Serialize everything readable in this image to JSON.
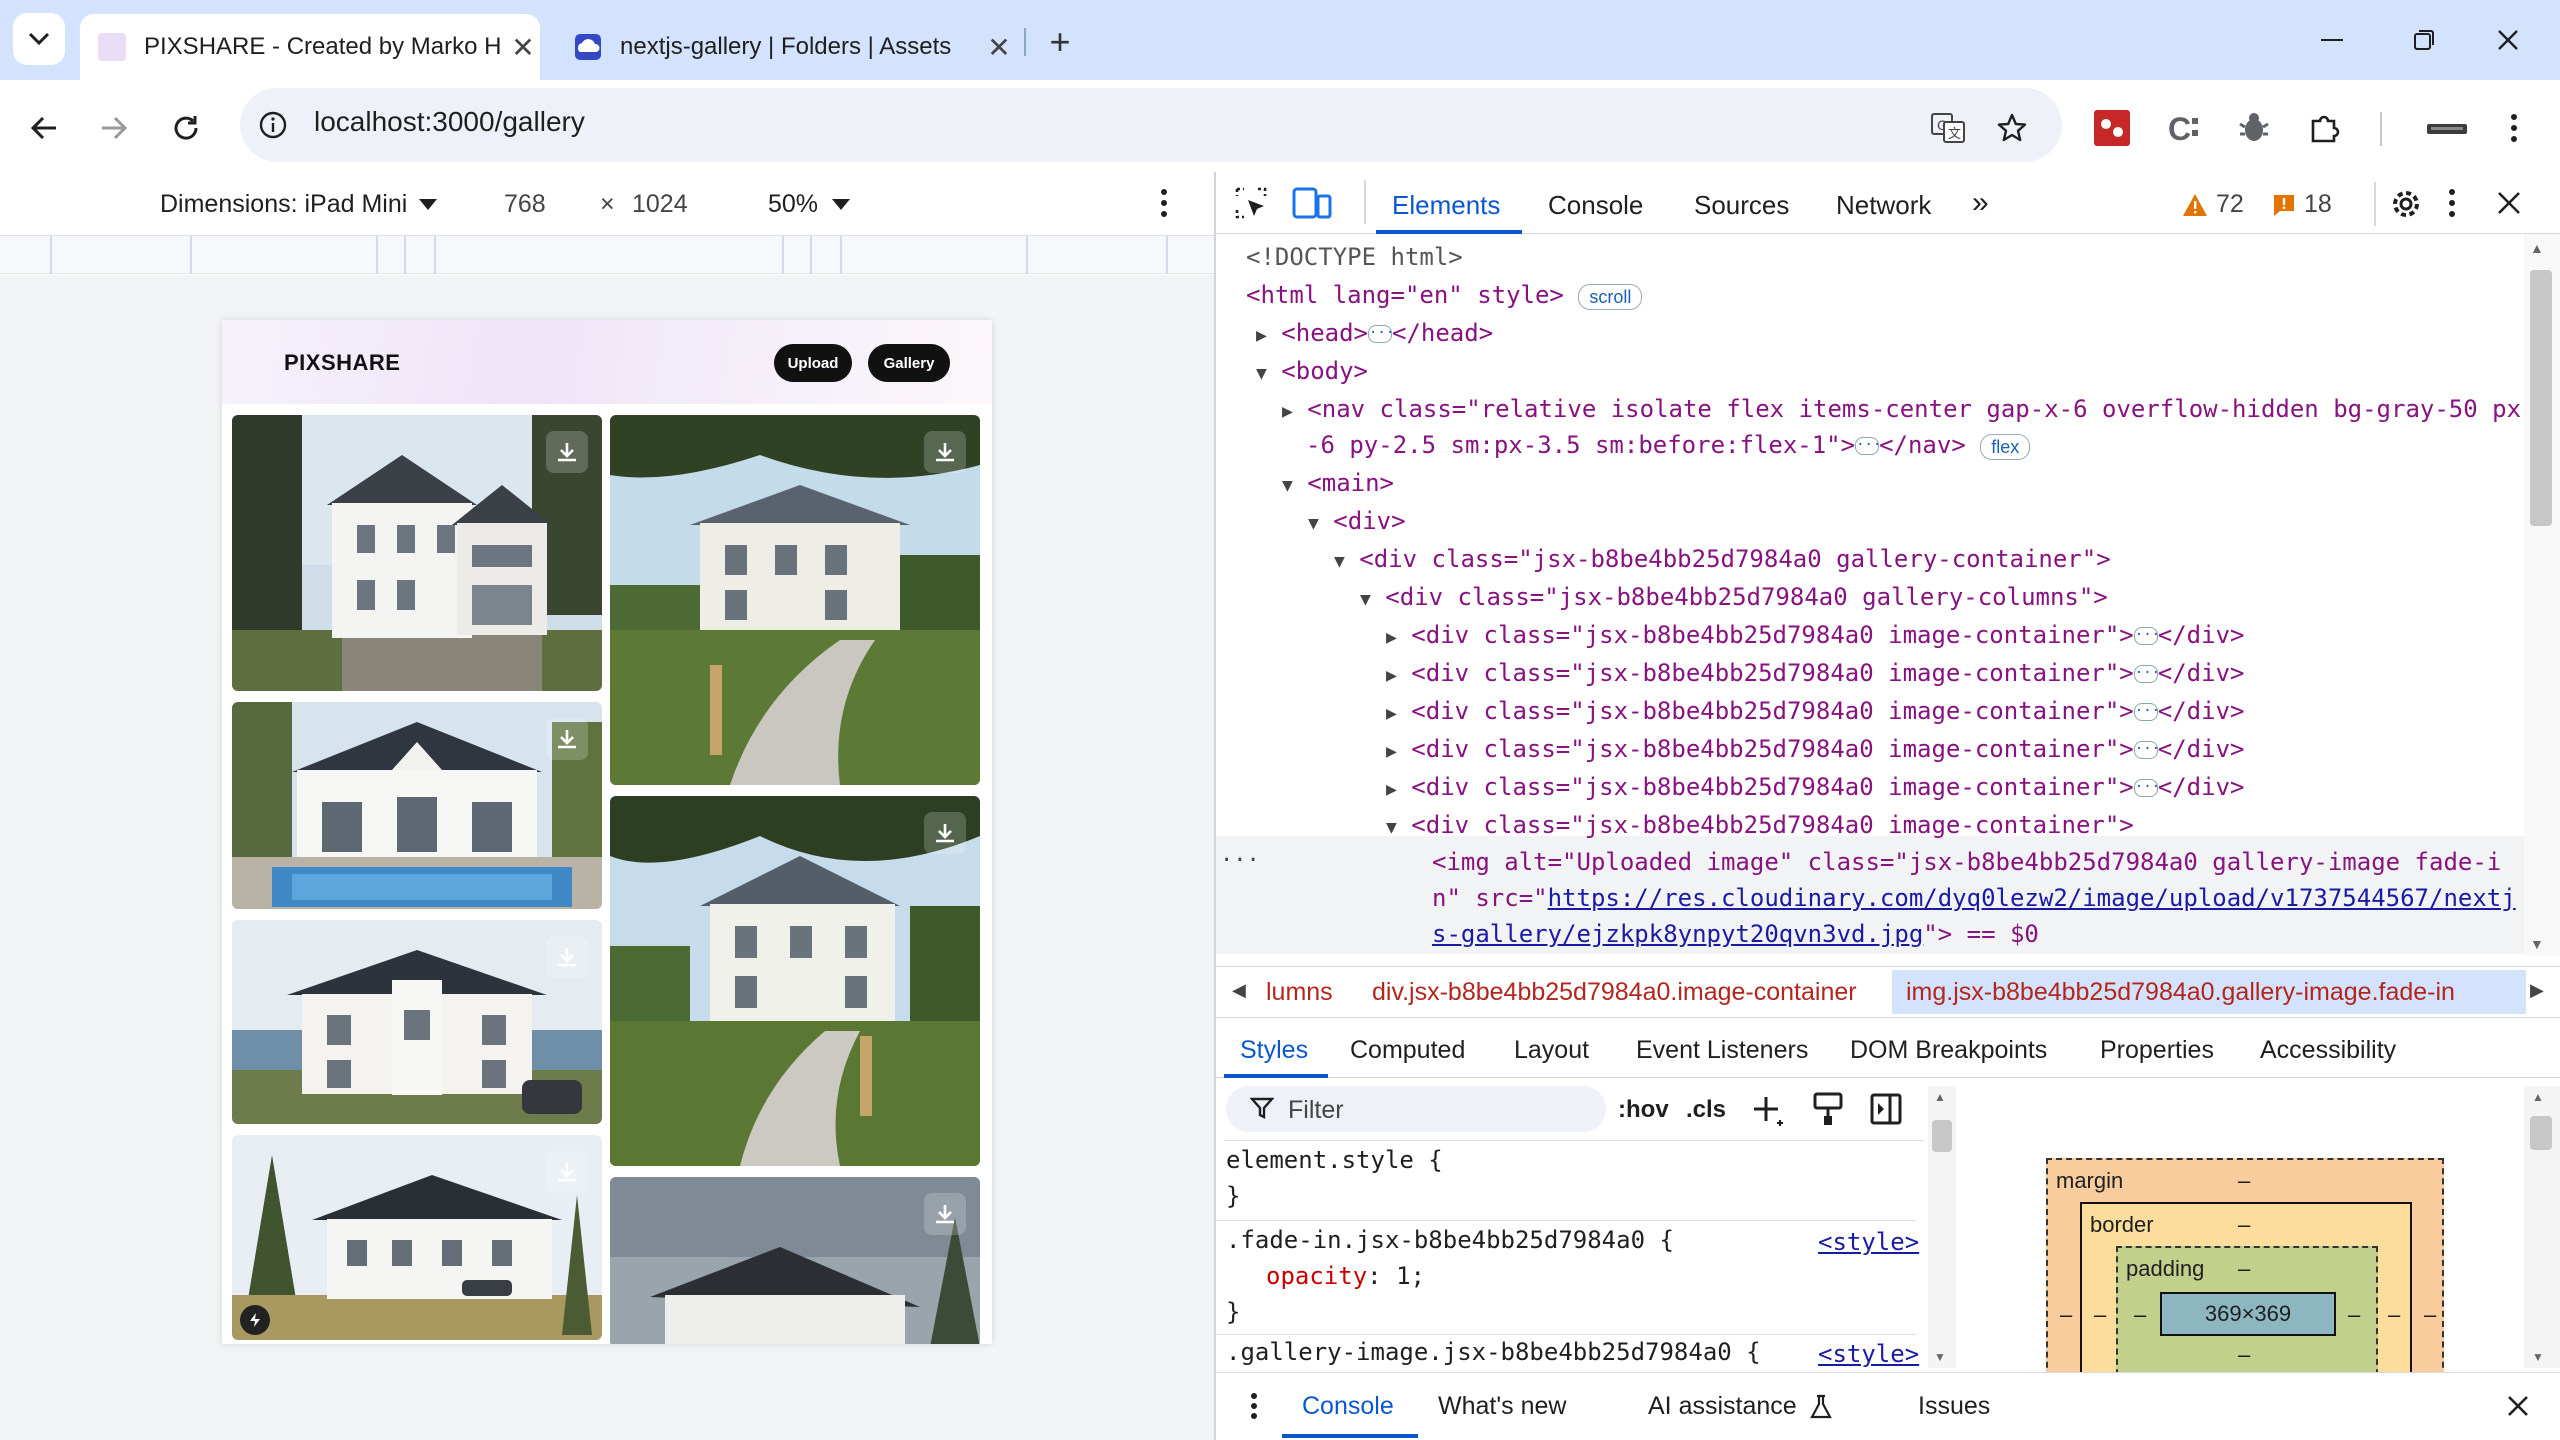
{
  "browser": {
    "tabs": [
      {
        "title": "PIXSHARE - Created by Marko H",
        "active": true
      },
      {
        "title": "nextjs-gallery | Folders | Assets",
        "active": false
      }
    ],
    "url": "localhost:3000/gallery"
  },
  "device_toolbar": {
    "dimensions_label": "Dimensions: iPad Mini",
    "width": "768",
    "times": "×",
    "height": "1024",
    "zoom": "50%"
  },
  "page": {
    "logo": "PIXSHARE",
    "upload_label": "Upload",
    "gallery_label": "Gallery"
  },
  "devtools": {
    "tabs": [
      "Elements",
      "Console",
      "Sources",
      "Network"
    ],
    "active_tab": "Elements",
    "warnings": "72",
    "issues": "18",
    "dom": {
      "doctype": "<!DOCTYPE html>",
      "html_open": "<html lang=\"en\" style>",
      "scroll_badge": "scroll",
      "head": "<head>",
      "head_close": "</head>",
      "body": "<body>",
      "nav_line1": "<nav class=\"relative isolate flex items-center gap-x-6 overflow-hidden bg-gray-50 px",
      "nav_line2": "-6 py-2.5 sm:px-3.5 sm:before:flex-1\">",
      "nav_close": "</nav>",
      "flex_badge": "flex",
      "main": "<main>",
      "div": "<div>",
      "gallery_container": "<div class=\"jsx-b8be4bb25d7984a0 gallery-container\">",
      "gallery_columns": "<div class=\"jsx-b8be4bb25d7984a0 gallery-columns\">",
      "image_container": "<div class=\"jsx-b8be4bb25d7984a0 image-container\">",
      "div_close": "</div>",
      "img_line1": "<img alt=\"Uploaded image\" class=\"jsx-b8be4bb25d7984a0 gallery-image fade-i",
      "img_line2_pre": "n\" src=\"",
      "img_src1": "https://res.cloudinary.com/dyq0lezw2/image/upload/v1737544567/nextj",
      "img_src2": "s-gallery/ejzkpk8ynpyt20qvn3vd.jpg",
      "img_line3_post": "\"> == $0"
    },
    "breadcrumbs": [
      "lumns",
      "div.jsx-b8be4bb25d7984a0.image-container",
      "img.jsx-b8be4bb25d7984a0.gallery-image.fade-in"
    ],
    "subtabs": [
      "Styles",
      "Computed",
      "Layout",
      "Event Listeners",
      "DOM Breakpoints",
      "Properties",
      "Accessibility"
    ],
    "filter_placeholder": "Filter",
    "hov": ":hov",
    "cls": ".cls",
    "styles": {
      "rule1_selector": "element.style {",
      "close": "}",
      "rule2_selector": ".fade-in.jsx-b8be4bb25d7984a0 {",
      "rule2_prop": "opacity",
      "rule2_val": "1;",
      "rule3_selector": ".gallery-image.jsx-b8be4bb25d7984a0 {",
      "source": "<style>"
    },
    "box_model": {
      "margin": "margin",
      "border": "border",
      "padding": "padding",
      "dash": "–",
      "content": "369×369"
    },
    "drawer_tabs": [
      "Console",
      "What's new",
      "AI assistance",
      "Issues"
    ]
  }
}
